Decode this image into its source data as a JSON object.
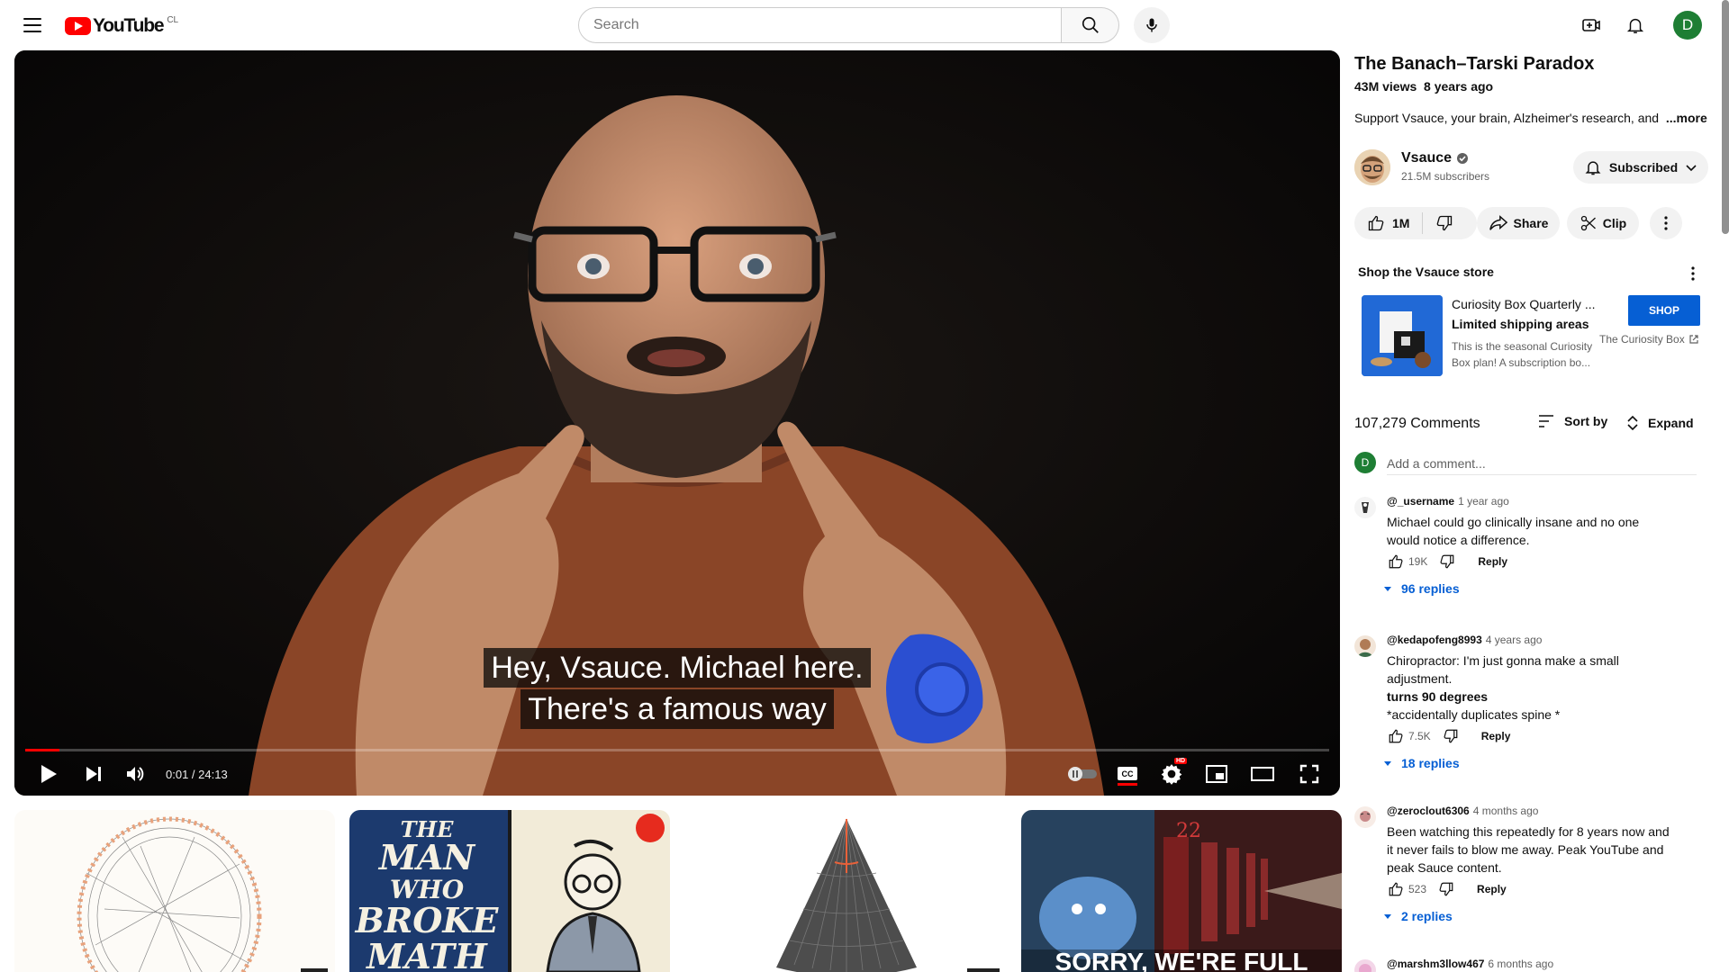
{
  "header": {
    "logo_text": "YouTube",
    "logo_country": "CL",
    "search_placeholder": "Search",
    "avatar_letter": "D",
    "icons": [
      "menu-icon",
      "search-icon",
      "mic-icon",
      "create-icon",
      "bell-icon"
    ]
  },
  "player": {
    "captions": [
      "Hey, Vsauce. Michael here.",
      "There's a famous way"
    ],
    "current_time": "0:01",
    "duration": "24:13",
    "time_display": "0:01 / 24:13",
    "progress": 0.026,
    "settings_badge": "HD",
    "accent_color": "#ff0000"
  },
  "video": {
    "title": "The Banach–Tarski Paradox",
    "views": "43M views",
    "age": "8 years ago",
    "description": "Support Vsauce, your brain, Alzheimer's research, and",
    "more_label": "...more"
  },
  "channel": {
    "name": "Vsauce",
    "subscribers": "21.5M subscribers",
    "subscribe_label": "Subscribed"
  },
  "actions": {
    "likes": "1M",
    "share_label": "Share",
    "clip_label": "Clip"
  },
  "shop": {
    "title": "Shop the Vsauce store",
    "product_name": "Curiosity Box Quarterly ...",
    "shipping": "Limited shipping areas",
    "desc_line1": "This is the seasonal Curiosity",
    "desc_line2": "Box plan! A subscription bo...",
    "button_label": "SHOP",
    "store_name": "The Curiosity Box",
    "button_color": "#065fd4"
  },
  "comments_section": {
    "count_label": "107,279 Comments",
    "sort_label": "Sort by",
    "expand_label": "Expand",
    "add_placeholder": "Add a comment...",
    "user_letter": "D",
    "reply_label": "Reply"
  },
  "comments": [
    {
      "author": "@_username",
      "time": "1 year ago",
      "line1": "Michael could go clinically insane and no one",
      "line2": "would notice a difference.",
      "likes": "19K",
      "replies": "96 replies"
    },
    {
      "author": "@kedapofeng8993",
      "time": "4 years ago",
      "line1": "Chiropractor: I'm just gonna make a small",
      "line2": "adjustment.",
      "line3": "turns 90 degrees",
      "line4": "*accidentally duplicates spine *",
      "likes": "7.5K",
      "replies": "18 replies"
    },
    {
      "author": "@zeroclout6306",
      "time": "4 months ago",
      "line1": "Been watching this repeatedly for 8 years now and",
      "line2": "it never fails to blow me away. Peak YouTube and",
      "line3": "peak Sauce content.",
      "likes": "523",
      "replies": "2 replies"
    },
    {
      "author": "@marshm3llow467",
      "time": "6 months ago"
    }
  ],
  "recommendations": [
    {
      "thumb_text": ""
    },
    {
      "thumb_text": "THE MAN WHO BROKE MATH",
      "badge": "TEDEd"
    },
    {
      "thumb_text": ""
    },
    {
      "thumb_text": "SORRY, WE'RE FULL",
      "sign": "22"
    }
  ]
}
